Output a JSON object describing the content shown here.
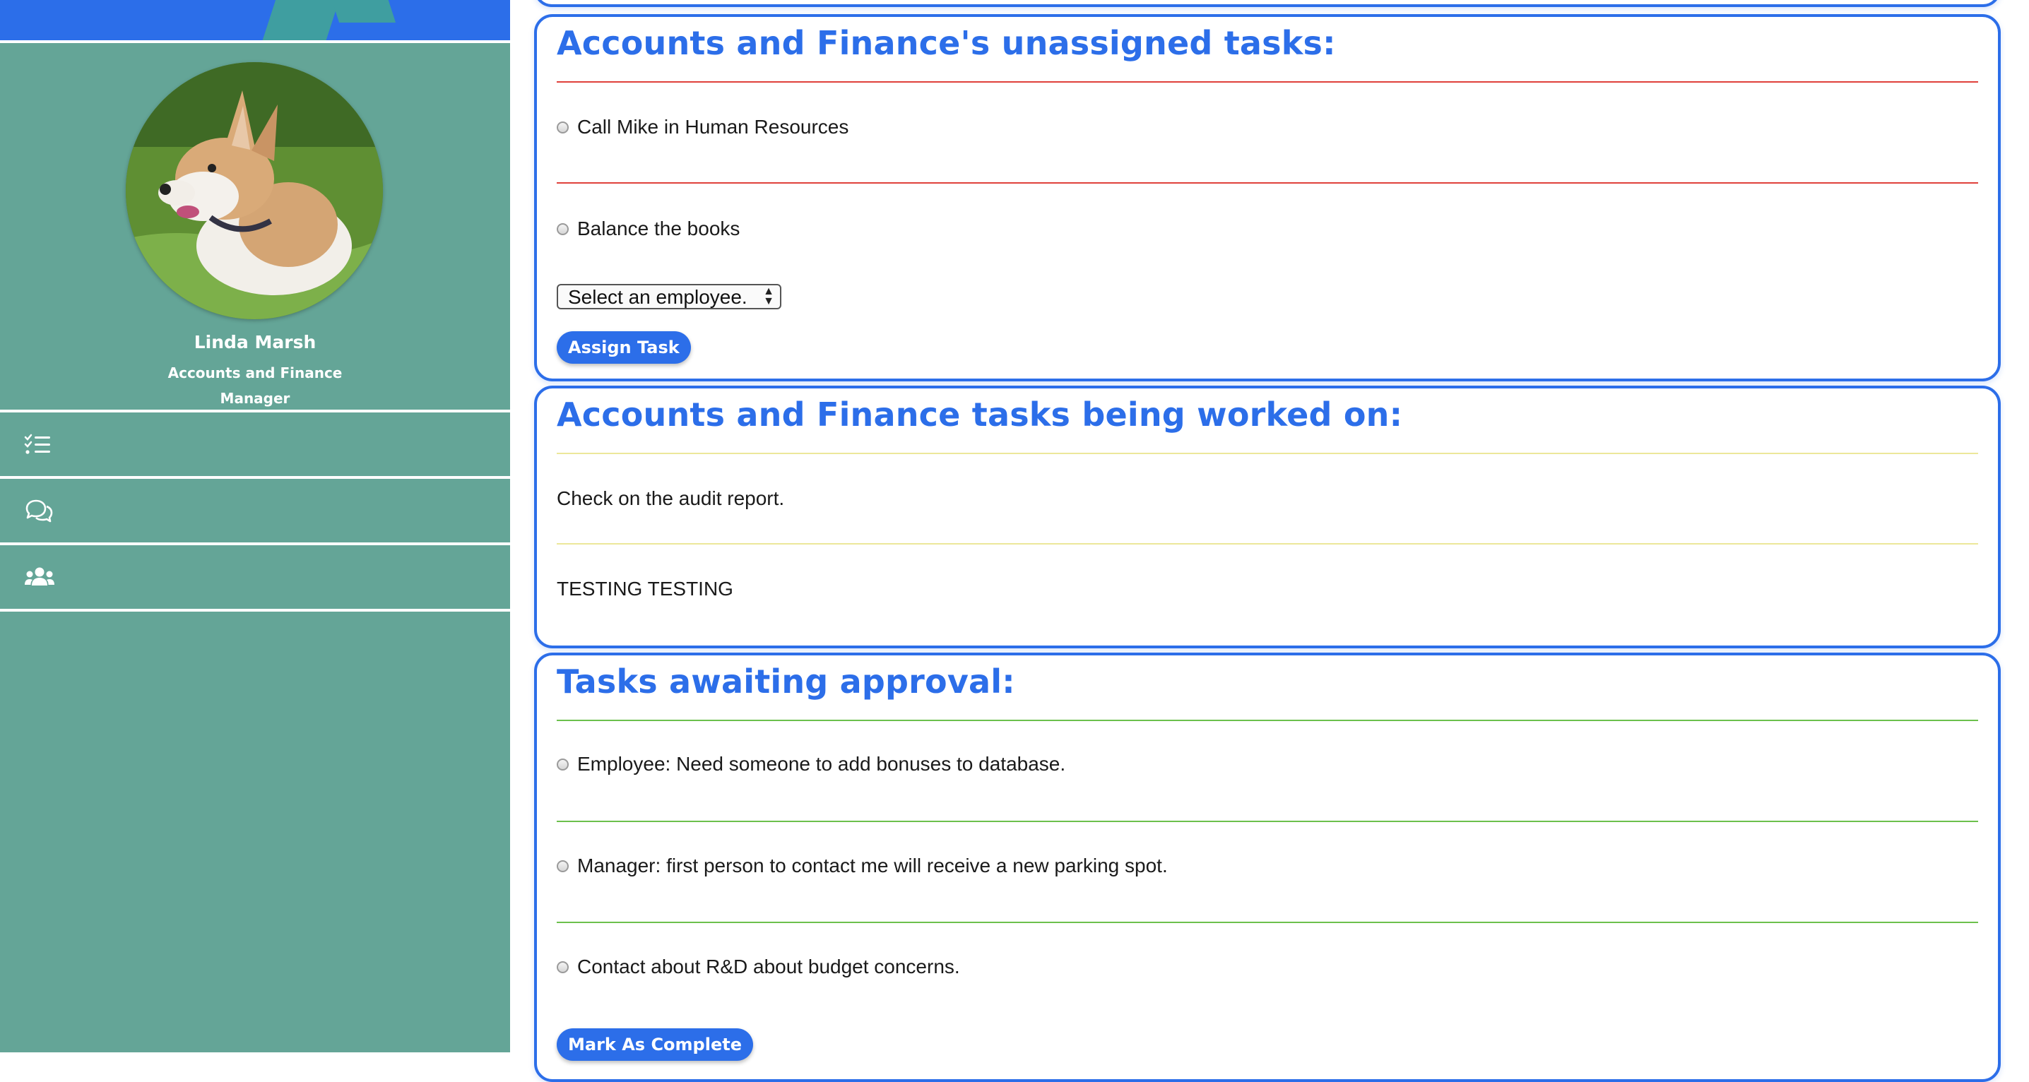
{
  "profile": {
    "name": "Linda Marsh",
    "department": "Accounts and Finance",
    "role": "Manager"
  },
  "nav": {
    "items": [
      {
        "icon": "tasks-icon"
      },
      {
        "icon": "chat-icon"
      },
      {
        "icon": "users-icon"
      }
    ]
  },
  "colors": {
    "sidebar": "#64a597",
    "accent": "#2c6ee9",
    "unassigned_rule": "#e0413b",
    "in_progress_rule": "#ece79a",
    "approval_rule": "#6cc04c"
  },
  "unassigned": {
    "title": "Accounts and Finance's unassigned tasks:",
    "tasks": [
      "Call Mike in Human Resources",
      "Balance the books"
    ],
    "select_value": "Select an employee.",
    "assign_label": "Assign Task"
  },
  "in_progress": {
    "title": "Accounts and Finance tasks being worked on:",
    "tasks": [
      "Check on the audit report.",
      "TESTING TESTING"
    ]
  },
  "approval": {
    "title": "Tasks awaiting approval:",
    "tasks": [
      "Employee: Need someone to add bonuses to database.",
      "Manager: first person to contact me will receive a new parking spot.",
      "Contact about R&D about budget concerns."
    ],
    "complete_label": "Mark As Complete"
  }
}
